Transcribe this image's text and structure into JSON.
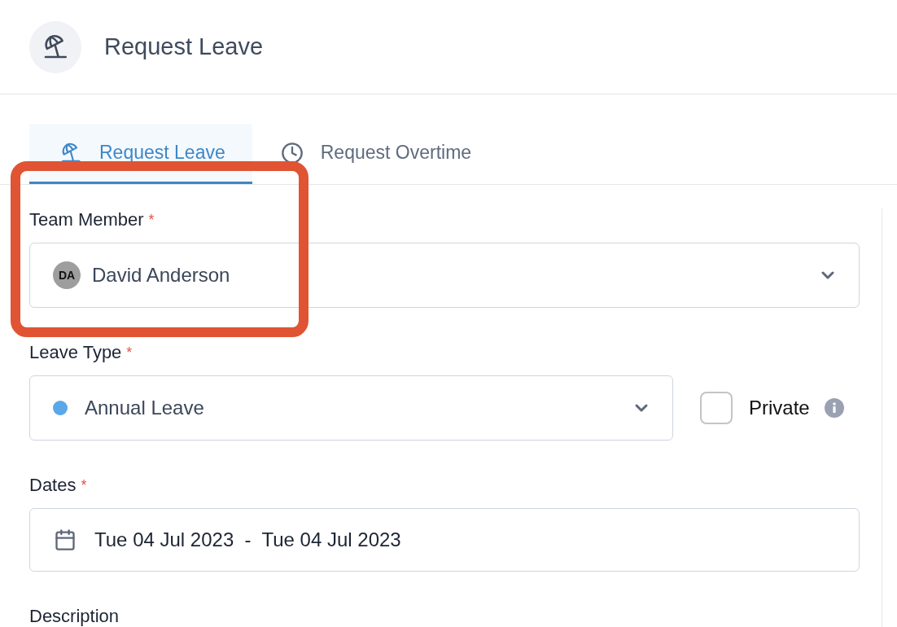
{
  "header": {
    "title": "Request Leave"
  },
  "tabs": [
    {
      "label": "Request Leave",
      "selected": true
    },
    {
      "label": "Request Overtime",
      "selected": false
    }
  ],
  "form": {
    "fields": [
      {
        "kind": "person-select",
        "label": "Team Member",
        "required_mark": "*",
        "initials": "DA",
        "value": "David Anderson"
      },
      {
        "kind": "type-select",
        "label": "Leave Type",
        "required_mark": "*",
        "value": "Annual Leave",
        "color": "#5aa8e8",
        "private": {
          "label": "Private",
          "checked": false
        }
      },
      {
        "kind": "date-range",
        "label": "Dates",
        "required_mark": "*",
        "value": "Tue 04 Jul 2023  -  Tue 04 Jul 2023"
      },
      {
        "kind": "text",
        "label": "Description"
      }
    ]
  },
  "annotation": {
    "kind": "highlight"
  }
}
